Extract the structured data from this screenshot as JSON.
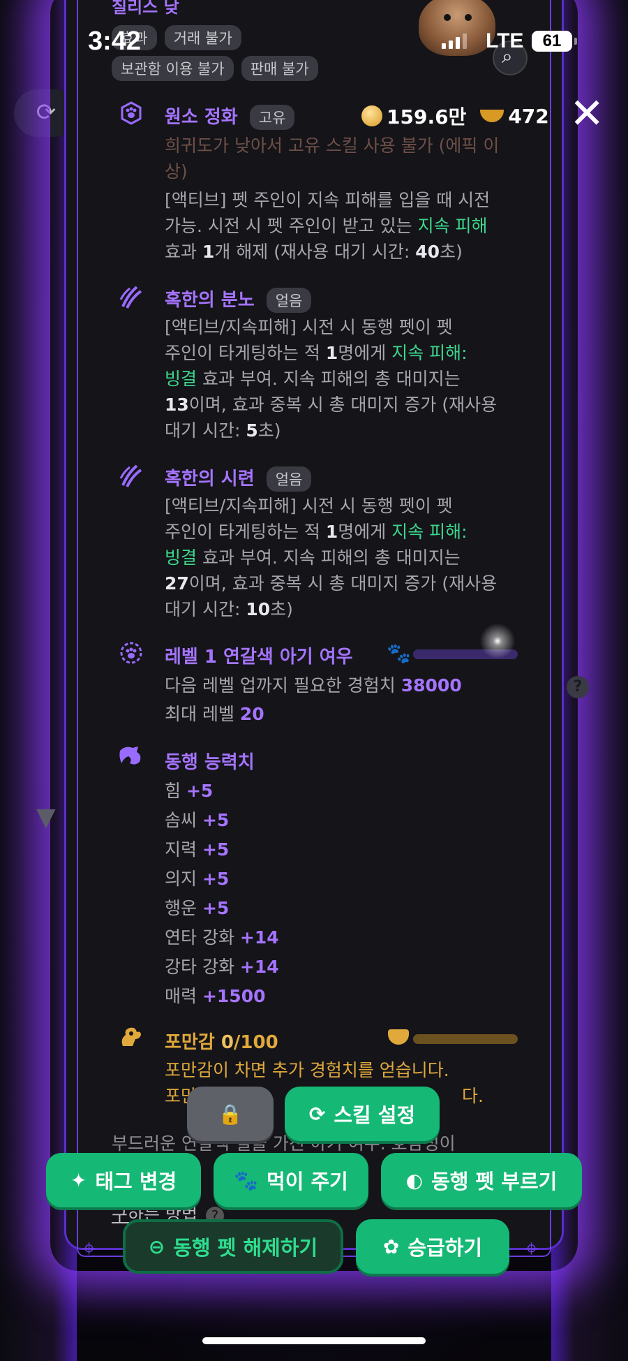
{
  "status": {
    "time": "3:42",
    "network": "LTE",
    "battery": "61"
  },
  "top_tags": [
    "효과",
    "거래 불가",
    "보관함 이용 불가",
    "판매 불가"
  ],
  "top_partial": "칠리스 낮",
  "currency": {
    "gold": "159.6만",
    "food": "472"
  },
  "skill1": {
    "title": "원소 정화",
    "badge": "고유",
    "warning": "희귀도가 낮아서 고유 스킬 사용 불가 (에픽 이상)",
    "desc_a": "[액티브] 펫 주인이 지속 피해를 입을 때 시전",
    "desc_b": "가능. 시전 시 펫 주인이 받고 있는 ",
    "desc_b_green": "지속 피해",
    "desc_c_1": "효과 ",
    "desc_c_num": "1",
    "desc_c_2": "개 해제 (재사용 대기 시간: ",
    "desc_c_num2": "40",
    "desc_c_3": "초)"
  },
  "skill2": {
    "title": "혹한의 분노",
    "badge": "얼음",
    "l1": "[액티브/지속피해] 시전 시 동행 펫이 펫",
    "l2a": "주인이 타게팅하는 적 ",
    "l2num": "1",
    "l2b": "명에게 ",
    "l2green": "지속 피해:",
    "l3green": "빙결",
    "l3": " 효과 부여. 지속 피해의 총 대미지는",
    "l4num": "13",
    "l4": "이며, 효과 중복 시 총 대미지 증가 (재사용",
    "l5a": "대기 시간: ",
    "l5num": "5",
    "l5b": "초)"
  },
  "skill3": {
    "title": "혹한의 시련",
    "badge": "얼음",
    "l1": "[액티브/지속피해] 시전 시 동행 펫이 펫",
    "l2a": "주인이 타게팅하는 적 ",
    "l2num": "1",
    "l2b": "명에게 ",
    "l2green": "지속 피해:",
    "l3green": "빙결",
    "l3": " 효과 부여. 지속 피해의 총 대미지는",
    "l4num": "27",
    "l4": "이며, 효과 중복 시 총 대미지 증가 (재사용",
    "l5a": "대기 시간: ",
    "l5num": "10",
    "l5b": "초)"
  },
  "level": {
    "title": "레벨 1 연갈색 아기 여우",
    "exp_label": "다음 레벨 업까지 필요한 경험치 ",
    "exp_value": "38000",
    "max_label": "최대 레벨 ",
    "max_value": "20",
    "progress": 0.0
  },
  "stats": {
    "title": "동행 능력치",
    "items": [
      {
        "name": "힘",
        "value": "+5"
      },
      {
        "name": "솜씨",
        "value": "+5"
      },
      {
        "name": "지력",
        "value": "+5"
      },
      {
        "name": "의지",
        "value": "+5"
      },
      {
        "name": "행운",
        "value": "+5"
      },
      {
        "name": "연타 강화",
        "value": "+14"
      },
      {
        "name": "강타 강화",
        "value": "+14"
      },
      {
        "name": "매력",
        "value": "+1500"
      }
    ]
  },
  "satiety": {
    "title": "포만감 ",
    "current": "0",
    "max": "/100",
    "line1": "포만감이 차면 추가 경험치를 얻습니다.",
    "line2_partial": "포만",
    "line2_end": "다.",
    "progress": 0.0
  },
  "description_partial": "부드러운 연갈색 털을 가진 아기 여우. 호감성이",
  "howto_label": "구하는 방법",
  "buttons": {
    "skill_settings": "스킬 설정",
    "tag_change": "태그 변경",
    "feed": "먹이 주기",
    "summon": "동행 펫 부르기",
    "release": "동행 펫 해제하기",
    "promote": "승급하기"
  },
  "colors": {
    "accent": "#a574ff",
    "green": "#3dd68c",
    "button": "#16b875",
    "gold": "#e1a93b"
  }
}
